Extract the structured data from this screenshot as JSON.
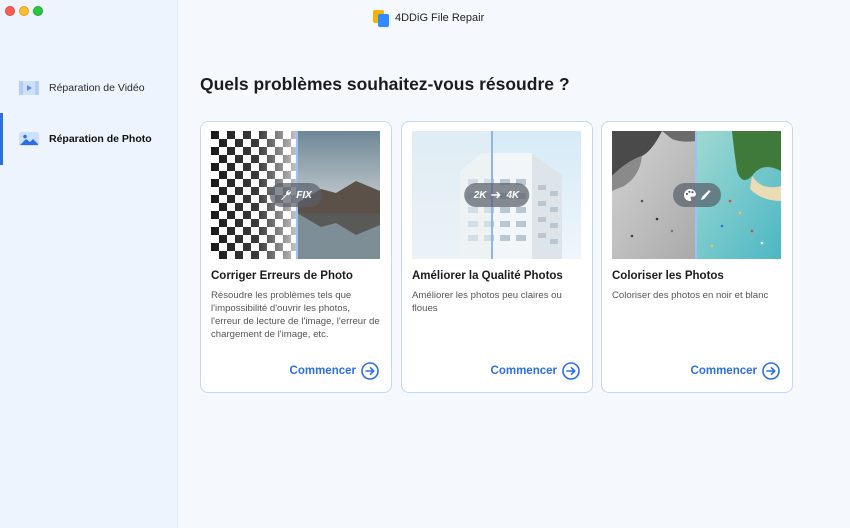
{
  "window": {
    "title": "4DDiG File Repair"
  },
  "sidebar": {
    "items": [
      {
        "label": "Réparation de Vidéo",
        "icon": "video-icon",
        "active": false
      },
      {
        "label": "Réparation de Photo",
        "icon": "photo-icon",
        "active": true
      }
    ]
  },
  "main": {
    "heading": "Quels problèmes souhaitez-vous résoudre ?",
    "cards": [
      {
        "title": "Corriger Erreurs de Photo",
        "description": "Résoudre les problèmes tels que l'impossibilité d'ouvrir les photos, l'erreur de lecture de l'image, l'erreur de chargement de l'image, etc.",
        "badge": "FIX",
        "badge_icon": "wrench-icon",
        "action": "Commencer"
      },
      {
        "title": "Améliorer la Qualité Photos",
        "description": "Améliorer les photos peu claires ou floues",
        "badge_from": "2K",
        "badge_to": "4K",
        "action": "Commencer"
      },
      {
        "title": "Coloriser les Photos",
        "description": "Coloriser des photos en noir et blanc",
        "badge_icon": "palette-brush-icon",
        "action": "Commencer"
      }
    ]
  },
  "colors": {
    "accent": "#2b6fe0",
    "card_border": "#c5d6f3",
    "sidebar_bg": "#edf4fd",
    "main_bg": "#f5f9fe"
  }
}
